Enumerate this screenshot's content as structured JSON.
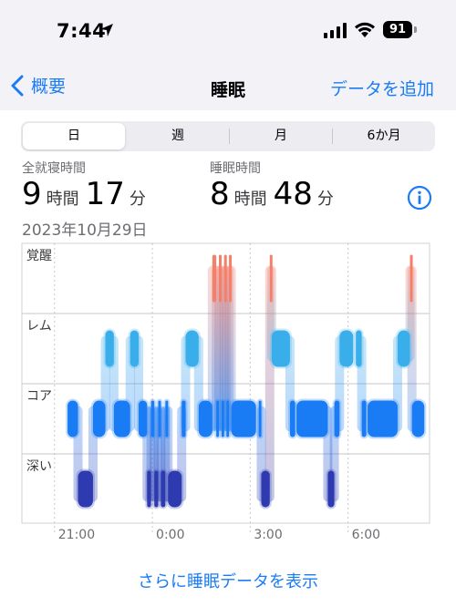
{
  "status_bar": {
    "time": "7:44",
    "battery": "91"
  },
  "nav": {
    "back_label": "概要",
    "title": "睡眠",
    "add_label": "データを追加"
  },
  "segments": [
    {
      "label": "日",
      "active": true
    },
    {
      "label": "週",
      "active": false
    },
    {
      "label": "月",
      "active": false
    },
    {
      "label": "6か月",
      "active": false
    }
  ],
  "stats": {
    "in_bed": {
      "label": "全就寝時間",
      "hours": "9",
      "hours_unit": "時間",
      "minutes": "17",
      "minutes_unit": "分"
    },
    "asleep": {
      "label": "睡眠時間",
      "hours": "8",
      "hours_unit": "時間",
      "minutes": "48",
      "minutes_unit": "分"
    }
  },
  "date": "2023年10月29日",
  "chart_data": {
    "type": "timeline",
    "stages": [
      "覚醒",
      "レム",
      "コア",
      "深い"
    ],
    "x_ticks": [
      "21:00",
      "0:00",
      "3:00",
      "6:00"
    ],
    "x_start_hour": 20.0,
    "x_end_hour": 32.5,
    "colors": {
      "覚醒": "#f47f6b",
      "レム": "#3aaeea",
      "コア": "#1a7cf5",
      "深い": "#2d3ab0"
    },
    "segments": [
      {
        "stage": "コア",
        "start": 21.4,
        "end": 21.72
      },
      {
        "stage": "深い",
        "start": 21.72,
        "end": 22.18
      },
      {
        "stage": "コア",
        "start": 22.18,
        "end": 22.56
      },
      {
        "stage": "レム",
        "start": 22.56,
        "end": 22.82
      },
      {
        "stage": "コア",
        "start": 22.82,
        "end": 23.32
      },
      {
        "stage": "レム",
        "start": 23.32,
        "end": 23.58
      },
      {
        "stage": "コア",
        "start": 23.58,
        "end": 23.84
      },
      {
        "stage": "深い",
        "start": 23.84,
        "end": 23.96
      },
      {
        "stage": "コア",
        "start": 23.96,
        "end": 24.06
      },
      {
        "stage": "深い",
        "start": 24.06,
        "end": 24.18
      },
      {
        "stage": "コア",
        "start": 24.18,
        "end": 24.26
      },
      {
        "stage": "深い",
        "start": 24.26,
        "end": 24.4
      },
      {
        "stage": "コア",
        "start": 24.4,
        "end": 24.48
      },
      {
        "stage": "深い",
        "start": 24.48,
        "end": 24.9
      },
      {
        "stage": "コア",
        "start": 24.9,
        "end": 25.02
      },
      {
        "stage": "レム",
        "start": 25.02,
        "end": 25.42
      },
      {
        "stage": "コア",
        "start": 25.42,
        "end": 25.84
      },
      {
        "stage": "覚醒",
        "start": 25.84,
        "end": 25.96
      },
      {
        "stage": "コア",
        "start": 25.96,
        "end": 26.04
      },
      {
        "stage": "覚醒",
        "start": 26.04,
        "end": 26.12
      },
      {
        "stage": "コア",
        "start": 26.12,
        "end": 26.2
      },
      {
        "stage": "覚醒",
        "start": 26.2,
        "end": 26.27
      },
      {
        "stage": "コア",
        "start": 26.27,
        "end": 26.35
      },
      {
        "stage": "覚醒",
        "start": 26.35,
        "end": 26.42
      },
      {
        "stage": "コア",
        "start": 26.42,
        "end": 27.18
      },
      {
        "stage": "コア",
        "start": 27.26,
        "end": 27.34
      },
      {
        "stage": "深い",
        "start": 27.34,
        "end": 27.6
      },
      {
        "stage": "覚醒",
        "start": 27.6,
        "end": 27.66
      },
      {
        "stage": "レム",
        "start": 27.66,
        "end": 28.22
      },
      {
        "stage": "コア",
        "start": 28.22,
        "end": 28.38
      },
      {
        "stage": "コア",
        "start": 28.42,
        "end": 29.38
      },
      {
        "stage": "深い",
        "start": 29.38,
        "end": 29.58
      },
      {
        "stage": "コア",
        "start": 29.58,
        "end": 29.74
      },
      {
        "stage": "レム",
        "start": 29.74,
        "end": 30.16
      },
      {
        "stage": "レム",
        "start": 30.24,
        "end": 30.42
      },
      {
        "stage": "コア",
        "start": 30.42,
        "end": 30.56
      },
      {
        "stage": "コア",
        "start": 30.6,
        "end": 31.52
      },
      {
        "stage": "レム",
        "start": 31.52,
        "end": 31.9
      },
      {
        "stage": "覚醒",
        "start": 31.9,
        "end": 31.96
      },
      {
        "stage": "コア",
        "start": 31.96,
        "end": 32.34
      }
    ]
  },
  "bottom_link": "さらに睡眠データを表示"
}
